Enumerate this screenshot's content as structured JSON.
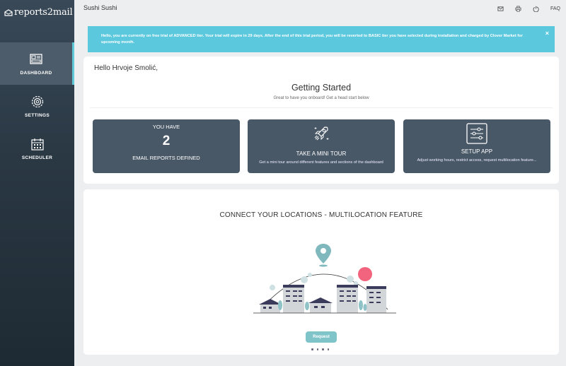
{
  "brand": {
    "name": "reports2mail"
  },
  "sidebar": {
    "items": [
      {
        "label": "DASHBOARD",
        "icon": "dashboard-icon",
        "active": true
      },
      {
        "label": "SETTINGS",
        "icon": "gear-icon",
        "active": false
      },
      {
        "label": "SCHEDULER",
        "icon": "calendar-icon",
        "active": false
      }
    ]
  },
  "topbar": {
    "title": "Sushi Sushi",
    "icons": [
      "mail-icon",
      "printer-icon",
      "logout-icon"
    ],
    "faq": "FAQ"
  },
  "alert": {
    "text": "Hello, you are currently on free trial of ADVANCED tier. Your trial will expire in 29 days. After the end of this trial period, you will be reverted to BASIC tier you have selected during installation and charged by Clover Market for upcoming month.",
    "close": "×"
  },
  "greeting": "Hello Hrvoje Smolić,",
  "getting_started": {
    "title": "Getting Started",
    "subtitle": "Great to have you onboard! Get a head start below"
  },
  "tiles": {
    "reports": {
      "top": "YOU HAVE",
      "count": "2",
      "bottom": "EMAIL REPORTS DEFINED"
    },
    "tour": {
      "title": "TAKE A MINI TOUR",
      "desc": "Get a mini tour around different features and sections of the dashboard"
    },
    "setup": {
      "title": "SETUP APP",
      "desc": "Adjust working hours, restrict access, request multilocation feature..."
    }
  },
  "multilocation": {
    "title": "CONNECT YOUR LOCATIONS - MULTILOCATION FEATURE",
    "button": "Request"
  },
  "colors": {
    "sidebar": "#2b3945",
    "accent": "#5bc8de",
    "tile": "#495867",
    "button": "#7fc4c9",
    "pin": "#7fb8bd",
    "sun": "#f2637e"
  }
}
